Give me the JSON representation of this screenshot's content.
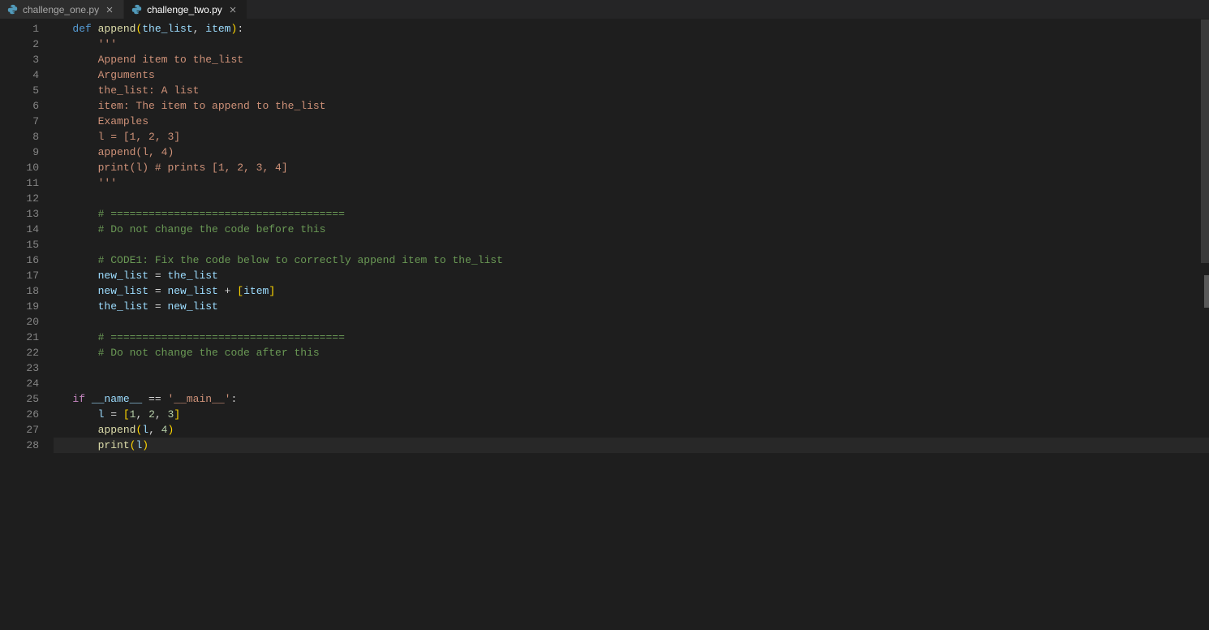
{
  "tabs": [
    {
      "label": "challenge_one.py",
      "active": false,
      "icon": "python-file-icon"
    },
    {
      "label": "challenge_two.py",
      "active": true,
      "icon": "python-file-icon"
    }
  ],
  "code": {
    "lines": [
      {
        "n": 1,
        "tokens": [
          [
            "kw",
            "def "
          ],
          [
            "fn",
            "append"
          ],
          [
            "brk",
            "("
          ],
          [
            "var",
            "the_list"
          ],
          [
            "op",
            ", "
          ],
          [
            "var",
            "item"
          ],
          [
            "brk",
            ")"
          ],
          [
            "op",
            ":"
          ]
        ]
      },
      {
        "n": 2,
        "tokens": [
          [
            "op",
            "    "
          ],
          [
            "str",
            "'''"
          ]
        ]
      },
      {
        "n": 3,
        "tokens": [
          [
            "op",
            "    "
          ],
          [
            "str",
            "Append item to the_list"
          ]
        ]
      },
      {
        "n": 4,
        "tokens": [
          [
            "op",
            "    "
          ],
          [
            "str",
            "Arguments"
          ]
        ]
      },
      {
        "n": 5,
        "tokens": [
          [
            "op",
            "    "
          ],
          [
            "str",
            "the_list: A list"
          ]
        ]
      },
      {
        "n": 6,
        "tokens": [
          [
            "op",
            "    "
          ],
          [
            "str",
            "item: The item to append to the_list"
          ]
        ]
      },
      {
        "n": 7,
        "tokens": [
          [
            "op",
            "    "
          ],
          [
            "str",
            "Examples"
          ]
        ]
      },
      {
        "n": 8,
        "tokens": [
          [
            "op",
            "    "
          ],
          [
            "str",
            "l = [1, 2, 3]"
          ]
        ]
      },
      {
        "n": 9,
        "tokens": [
          [
            "op",
            "    "
          ],
          [
            "str",
            "append(l, 4)"
          ]
        ]
      },
      {
        "n": 10,
        "tokens": [
          [
            "op",
            "    "
          ],
          [
            "str",
            "print(l) # prints [1, 2, 3, 4]"
          ]
        ]
      },
      {
        "n": 11,
        "tokens": [
          [
            "op",
            "    "
          ],
          [
            "str",
            "'''"
          ]
        ]
      },
      {
        "n": 12,
        "tokens": []
      },
      {
        "n": 13,
        "tokens": [
          [
            "op",
            "    "
          ],
          [
            "cmt",
            "# ====================================="
          ]
        ]
      },
      {
        "n": 14,
        "tokens": [
          [
            "op",
            "    "
          ],
          [
            "cmt",
            "# Do not change the code before this"
          ]
        ]
      },
      {
        "n": 15,
        "tokens": []
      },
      {
        "n": 16,
        "tokens": [
          [
            "op",
            "    "
          ],
          [
            "cmt",
            "# CODE1: Fix the code below to correctly append item to the_list"
          ]
        ]
      },
      {
        "n": 17,
        "tokens": [
          [
            "op",
            "    "
          ],
          [
            "var",
            "new_list"
          ],
          [
            "op",
            " = "
          ],
          [
            "var",
            "the_list"
          ]
        ]
      },
      {
        "n": 18,
        "tokens": [
          [
            "op",
            "    "
          ],
          [
            "var",
            "new_list"
          ],
          [
            "op",
            " = "
          ],
          [
            "var",
            "new_list"
          ],
          [
            "op",
            " + "
          ],
          [
            "brk",
            "["
          ],
          [
            "var",
            "item"
          ],
          [
            "brk",
            "]"
          ]
        ]
      },
      {
        "n": 19,
        "tokens": [
          [
            "op",
            "    "
          ],
          [
            "var",
            "the_list"
          ],
          [
            "op",
            " = "
          ],
          [
            "var",
            "new_list"
          ]
        ]
      },
      {
        "n": 20,
        "tokens": []
      },
      {
        "n": 21,
        "tokens": [
          [
            "op",
            "    "
          ],
          [
            "cmt",
            "# ====================================="
          ]
        ]
      },
      {
        "n": 22,
        "tokens": [
          [
            "op",
            "    "
          ],
          [
            "cmt",
            "# Do not change the code after this"
          ]
        ]
      },
      {
        "n": 23,
        "tokens": []
      },
      {
        "n": 24,
        "tokens": []
      },
      {
        "n": 25,
        "tokens": [
          [
            "kw2",
            "if"
          ],
          [
            "op",
            " "
          ],
          [
            "var",
            "__name__"
          ],
          [
            "op",
            " == "
          ],
          [
            "str",
            "'__main__'"
          ],
          [
            "op",
            ":"
          ]
        ]
      },
      {
        "n": 26,
        "tokens": [
          [
            "op",
            "    "
          ],
          [
            "var",
            "l"
          ],
          [
            "op",
            " = "
          ],
          [
            "brk",
            "["
          ],
          [
            "num",
            "1"
          ],
          [
            "op",
            ", "
          ],
          [
            "num",
            "2"
          ],
          [
            "op",
            ", "
          ],
          [
            "num",
            "3"
          ],
          [
            "brk",
            "]"
          ]
        ]
      },
      {
        "n": 27,
        "tokens": [
          [
            "op",
            "    "
          ],
          [
            "fn",
            "append"
          ],
          [
            "brk",
            "("
          ],
          [
            "var",
            "l"
          ],
          [
            "op",
            ", "
          ],
          [
            "num",
            "4"
          ],
          [
            "brk",
            ")"
          ]
        ]
      },
      {
        "n": 28,
        "current": true,
        "tokens": [
          [
            "op",
            "    "
          ],
          [
            "fn",
            "print"
          ],
          [
            "brk",
            "("
          ],
          [
            "var",
            "l"
          ],
          [
            "brk",
            ")"
          ]
        ]
      }
    ]
  }
}
